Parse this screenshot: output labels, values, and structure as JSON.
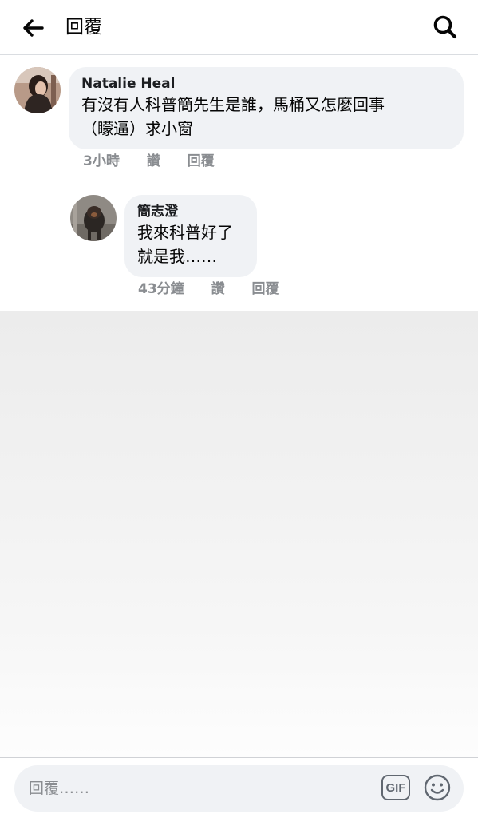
{
  "header": {
    "title": "回覆",
    "back_icon": "arrow-left-icon",
    "search_icon": "search-icon"
  },
  "comment": {
    "author": "Natalie Heal",
    "text_lines": [
      "有沒有人科普簡先生是誰，馬桶又怎麼回事",
      "（矇逼）求小窗"
    ],
    "time": "3小時",
    "like_label": "讚",
    "reply_label": "回覆"
  },
  "reply": {
    "author": "簡志澄",
    "text_lines": [
      "我來科普好了",
      "就是我……"
    ],
    "time": "43分鐘",
    "like_label": "讚",
    "reply_label": "回覆"
  },
  "composer": {
    "placeholder": "回覆……",
    "gif_label": "GIF",
    "emoji_icon": "smiley-icon"
  },
  "colors": {
    "bubble_bg": "#f0f2f5",
    "meta_text": "#8a8d91",
    "divider": "#dadde1"
  }
}
